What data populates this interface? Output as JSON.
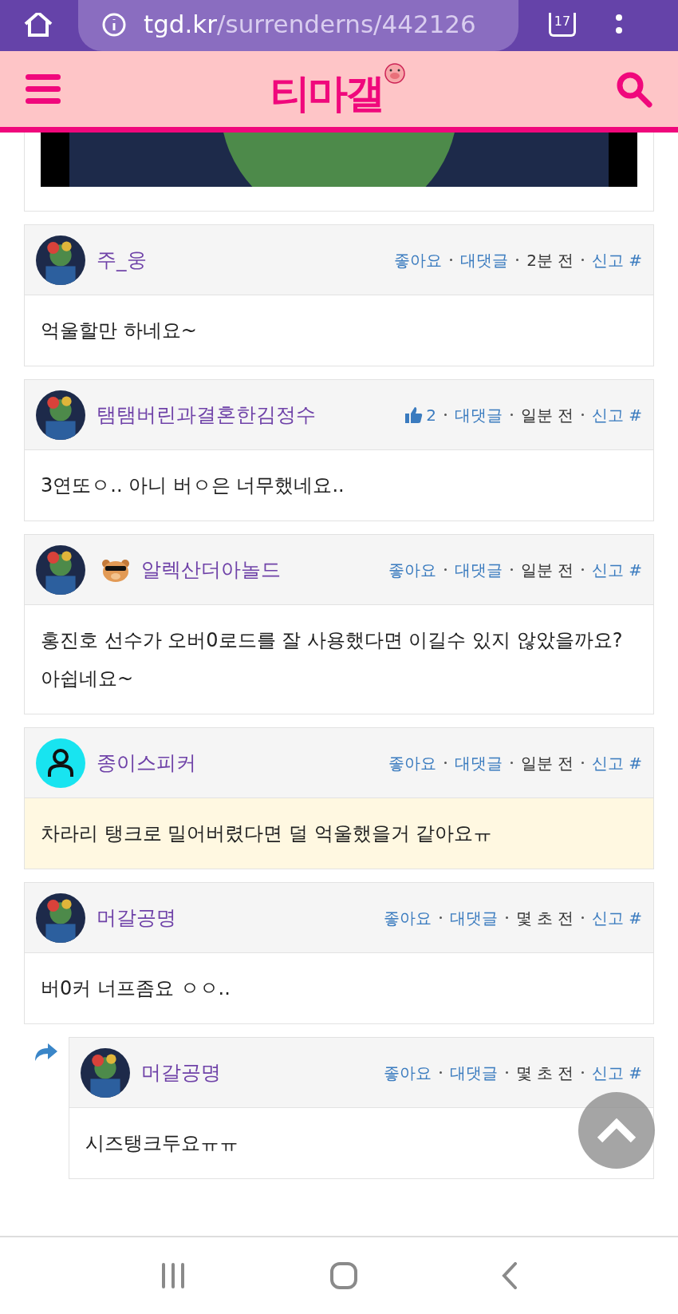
{
  "browser": {
    "url_host": "tgd.kr",
    "url_path": "/surrenderns/442126",
    "tab_count": "17"
  },
  "header": {
    "logo": "티마갤"
  },
  "comments": [
    {
      "author": "주_웅",
      "like": {
        "kind": "link",
        "text": "좋아요"
      },
      "reply_label": "대댓글",
      "time": "2분 전",
      "report": "신고",
      "anchor": "#",
      "body": "억울할만 하네요~",
      "highlighted": false
    },
    {
      "author": "탬탬버린과결혼한김정수",
      "like": {
        "kind": "count",
        "text": "2"
      },
      "reply_label": "대댓글",
      "time": "일분 전",
      "report": "신고",
      "anchor": "#",
      "body": "3연또ㅇ.. 아니 버ㅇ은 너무했네요..",
      "highlighted": false
    },
    {
      "author": "알렉산더아놀드",
      "has_badge": true,
      "like": {
        "kind": "link",
        "text": "좋아요"
      },
      "reply_label": "대댓글",
      "time": "일분 전",
      "report": "신고",
      "anchor": "#",
      "body": "홍진호 선수가 오버0로드를 잘 사용했다면 이길수 있지 않았을까요? 아쉽네요~",
      "highlighted": false
    },
    {
      "author": "종이스피커",
      "avatar": {
        "kind": "default"
      },
      "like": {
        "kind": "link",
        "text": "좋아요"
      },
      "reply_label": "대댓글",
      "time": "일분 전",
      "report": "신고",
      "anchor": "#",
      "body": "차라리 탱크로 밀어버렸다면 덜 억울했을거 같아요ㅠ",
      "highlighted": true
    },
    {
      "author": "머갈공명",
      "like": {
        "kind": "link",
        "text": "좋아요"
      },
      "reply_label": "대댓글",
      "time": "몇 초 전",
      "report": "신고",
      "anchor": "#",
      "body": "버0커 너프좀요 ㅇㅇ..",
      "highlighted": false,
      "children": [
        {
          "author": "머갈공명",
          "like": {
            "kind": "link",
            "text": "좋아요"
          },
          "reply_label": "대댓글",
          "time": "몇 초 전",
          "report": "신고",
          "anchor": "#",
          "body": "시즈탱크두요ㅠㅠ",
          "highlighted": false
        }
      ]
    }
  ]
}
